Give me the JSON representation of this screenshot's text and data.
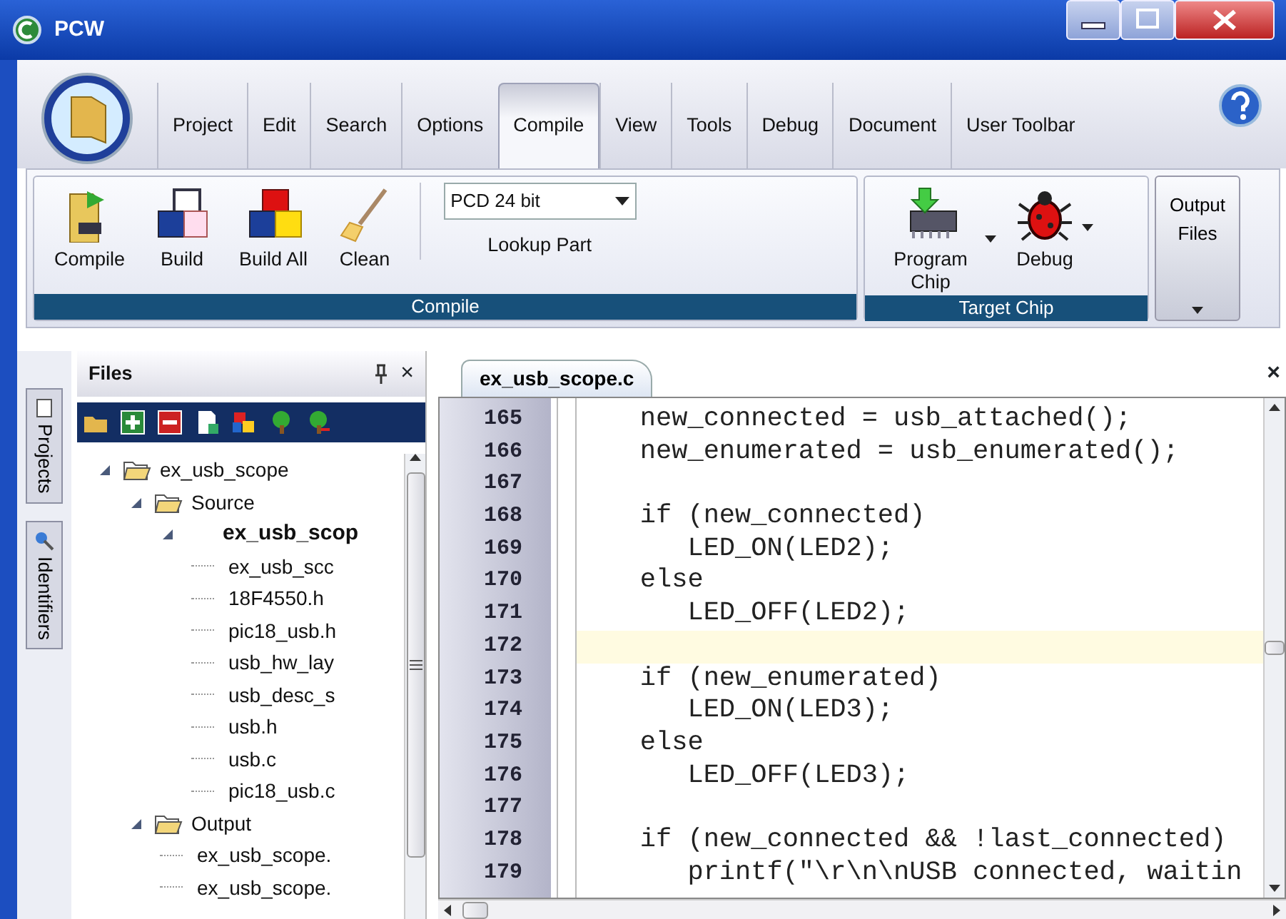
{
  "window": {
    "title": "PCW"
  },
  "ribbon_tabs": [
    {
      "label": "Project",
      "selected": false
    },
    {
      "label": "Edit",
      "selected": false
    },
    {
      "label": "Search",
      "selected": false
    },
    {
      "label": "Options",
      "selected": false
    },
    {
      "label": "Compile",
      "selected": true
    },
    {
      "label": "View",
      "selected": false
    },
    {
      "label": "Tools",
      "selected": false
    },
    {
      "label": "Debug",
      "selected": false
    },
    {
      "label": "Document",
      "selected": false
    },
    {
      "label": "User Toolbar",
      "selected": false
    }
  ],
  "ribbon_groups": [
    {
      "label": "Compile",
      "items": [
        {
          "kind": "compile",
          "label": "Compile"
        },
        {
          "kind": "build",
          "label": "Build"
        },
        {
          "kind": "buildall",
          "label": "Build All"
        },
        {
          "kind": "clean",
          "label": "Clean"
        },
        {
          "kind": "combo",
          "value": "PCD 24 bit",
          "label": "Lookup Part"
        }
      ]
    },
    {
      "label": "Target Chip",
      "items": [
        {
          "kind": "program",
          "label": "Program Chip",
          "has_menu": true
        },
        {
          "kind": "debug",
          "label": "Debug",
          "has_menu": true
        }
      ]
    }
  ],
  "output_button": {
    "label": "Output Files",
    "has_menu": true
  },
  "side_tabs": [
    {
      "label": "Projects"
    },
    {
      "label": "Identifiers"
    }
  ],
  "files_panel": {
    "title": "Files",
    "close": "×",
    "tree": [
      {
        "label": "ex_usb_scope",
        "kind": "folder",
        "active": false,
        "expanded": true,
        "children": [
          {
            "label": "Source",
            "kind": "folder",
            "active": false,
            "expanded": true,
            "children": [
              {
                "label": "ex_usb_scop",
                "kind": "file",
                "active": true,
                "expanded": true,
                "children": [
                  {
                    "label": "ex_usb_scc",
                    "kind": "file",
                    "active": false
                  },
                  {
                    "label": "18F4550.h",
                    "kind": "file",
                    "active": false
                  },
                  {
                    "label": "pic18_usb.h",
                    "kind": "file",
                    "active": false
                  },
                  {
                    "label": "usb_hw_lay",
                    "kind": "file",
                    "active": false
                  },
                  {
                    "label": "usb_desc_s",
                    "kind": "file",
                    "active": false
                  },
                  {
                    "label": "usb.h",
                    "kind": "file",
                    "active": false
                  },
                  {
                    "label": "usb.c",
                    "kind": "file",
                    "active": false
                  },
                  {
                    "label": "pic18_usb.c",
                    "kind": "file",
                    "active": false
                  }
                ]
              }
            ]
          },
          {
            "label": "Output",
            "kind": "folder",
            "active": false,
            "expanded": true,
            "children": [
              {
                "label": "ex_usb_scope.",
                "kind": "file",
                "active": false
              },
              {
                "label": "ex_usb_scope.",
                "kind": "file",
                "active": false
              }
            ]
          }
        ]
      }
    ]
  },
  "editor": {
    "tabs": [
      {
        "label": "ex_usb_scope.c",
        "selected": true
      }
    ],
    "close": "×",
    "lines": [
      {
        "number": "165",
        "code": "    new_connected = usb_attached();",
        "current": false
      },
      {
        "number": "166",
        "code": "    new_enumerated = usb_enumerated();",
        "current": false
      },
      {
        "number": "167",
        "current": false
      },
      {
        "number": "168",
        "code": "    if (new_connected)",
        "current": false
      },
      {
        "number": "169",
        "code": "       LED_ON(LED2);",
        "current": false
      },
      {
        "number": "170",
        "code": "    else",
        "current": false
      },
      {
        "number": "171",
        "code": "       LED_OFF(LED2);",
        "current": false
      },
      {
        "number": "172",
        "current": true
      },
      {
        "number": "173",
        "code": "    if (new_enumerated)",
        "current": false
      },
      {
        "number": "174",
        "code": "       LED_ON(LED3);",
        "current": false
      },
      {
        "number": "175",
        "code": "    else",
        "current": false
      },
      {
        "number": "176",
        "code": "       LED_OFF(LED3);",
        "current": false
      },
      {
        "number": "177",
        "current": false
      },
      {
        "number": "178",
        "code": "    if (new_connected && !last_connected)",
        "current": false
      },
      {
        "number": "179",
        "code": "       printf(\"\\r\\n\\nUSB connected, waitin",
        "current": false
      }
    ]
  }
}
